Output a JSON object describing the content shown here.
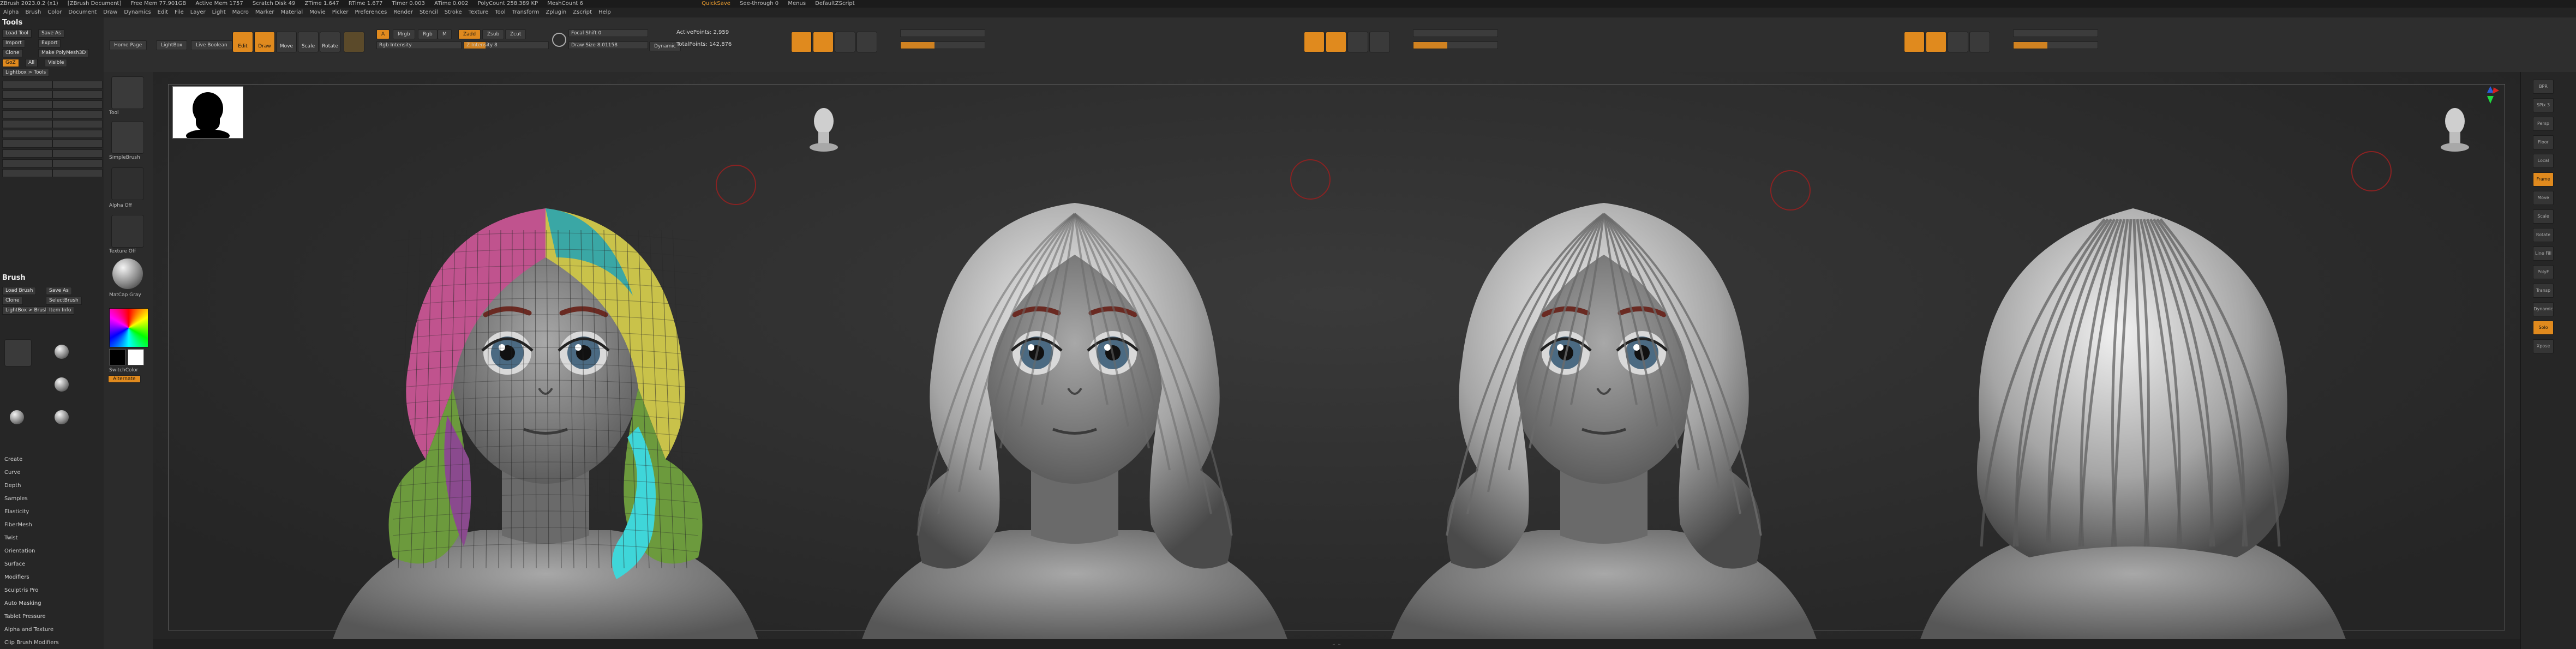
{
  "titlebar": {
    "app": "ZBrush 2023.0.2 (x1)",
    "doc": "[ZBrush Document]",
    "free_mem": "Free Mem 77.901GB",
    "active_mem": "Active Mem 1757",
    "scratch": "Scratch Disk 49",
    "ztime": "ZTime 1.647",
    "rtime": "RTime 1.677",
    "timer": "Timer 0.003",
    "atime": "ATime 0.002",
    "polycount": "PolyCount 258.389 KP",
    "meshcount": "MeshCount 6",
    "quicksave": "QuickSave",
    "see_through": "See-through 0",
    "menus": "Menus",
    "default_script": "DefaultZScript"
  },
  "menus": [
    "Alpha",
    "Brush",
    "Color",
    "Document",
    "Draw",
    "Dynamics",
    "Edit",
    "File",
    "Layer",
    "Light",
    "Macro",
    "Marker",
    "Material",
    "Movie",
    "Picker",
    "Preferences",
    "Render",
    "Stencil",
    "Stroke",
    "Texture",
    "Tool",
    "Transform",
    "Zplugin",
    "Zscript",
    "Help"
  ],
  "topshelf": {
    "home_page": "Home Page",
    "lightbox": "LightBox",
    "live_boolean": "Live Boolean",
    "edit": "Edit",
    "draw": "Draw",
    "move": "Move",
    "scale": "Scale",
    "rotate": "Rotate",
    "a_btn": "A",
    "mrgb": "Mrgb",
    "rgb": "Rgb",
    "m": "M",
    "zadd": "Zadd",
    "zsub": "Zsub",
    "zcut": "Zcut",
    "focal_shift": "Focal Shift 0",
    "draw_size": "Draw Size 8.01158",
    "z_intensity": "Z Intensity 8",
    "dynamic": "Dynamic",
    "active_points": "ActivePoints: 2,959",
    "total_points": "TotalPoints: 142,876",
    "rgb_intensity": "Rgb Intensity",
    "focal_value": 0.0,
    "intensity_value": 0.25
  },
  "lefttray": {
    "palette_title": "Tools",
    "tool_label": "Tool",
    "load_tool": "Load Tool",
    "save_as": "Save As",
    "import": "Import",
    "export": "Export",
    "clone": "Clone",
    "make_polymesh": "Make PolyMesh3D",
    "goz": "GoZ",
    "all": "All",
    "visible": "Visible",
    "lightbox_tools": "Lightbox > Tools",
    "brush_title": "Brush",
    "brush_items": [
      "Load Brush",
      "Save As",
      "Clone",
      "SelectBrush",
      "LightBox > Brushes",
      "Item Info"
    ],
    "subpalettes": [
      "Create",
      "Curve",
      "Depth",
      "Samples",
      "Elasticity",
      "FiberMesh",
      "Twist",
      "Orientation",
      "Surface",
      "Modifiers",
      "Sculptris Pro",
      "Auto Masking",
      "Tablet Pressure",
      "Alpha and Texture",
      "Clip Brush Modifiers"
    ]
  },
  "brushcol": {
    "current_tool": "Tool",
    "simple_brush": "SimpleBrush",
    "alpha_off": "Alpha Off",
    "texture_off": "Texture Off",
    "material": "MatCap Gray",
    "gradient": "Gradient",
    "switch_color": "SwitchColor",
    "alternate": "Alternate"
  },
  "canvas": {
    "views": [
      "front-colored",
      "front-gray",
      "front-gray-lit",
      "back-gray"
    ],
    "colors": {
      "polygroup_pink": "#c0538e",
      "polygroup_yellow": "#c9c24a",
      "polygroup_teal": "#3aa7a5",
      "polygroup_cyan": "#3fd6d9",
      "polygroup_green": "#6c9a3d",
      "polygroup_brown": "#8a4a3a",
      "skin": "#8e8e8e",
      "eye": "#4b6a82"
    }
  },
  "bottombar": {
    "label": "⌄ ⌄"
  },
  "rightshelf": {
    "items": [
      "BPR",
      "SPix 3",
      "Persp",
      "Floor",
      "Local",
      "Frame",
      "Move",
      "Scale",
      "Rotate",
      "Line Fill",
      "PolyF",
      "Transp",
      "Dynamic",
      "Solo",
      "Xpose"
    ]
  }
}
